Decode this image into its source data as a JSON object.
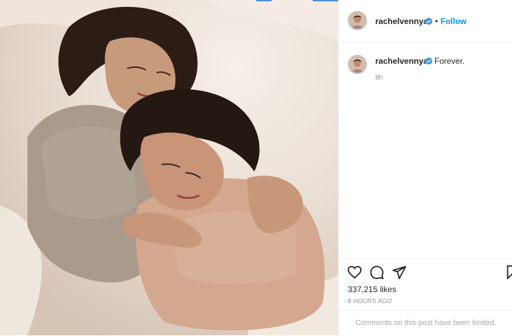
{
  "post": {
    "username": "rachelvennya",
    "follow_label": "Follow",
    "separator": "•",
    "caption": "Forever.",
    "caption_time": "8h",
    "likes": "337,215 likes",
    "posted_ago": "8 HOURS AGO",
    "comments_limited": "Comments on this post have been limited."
  },
  "icons": {
    "like": "heart-icon",
    "comment": "comment-icon",
    "share": "paper-plane-icon",
    "save": "bookmark-icon",
    "verified": "verified-badge-icon"
  },
  "colors": {
    "follow_blue": "#0095f6",
    "verified_blue": "#3897f0",
    "muted_text": "#8e8e8e"
  }
}
